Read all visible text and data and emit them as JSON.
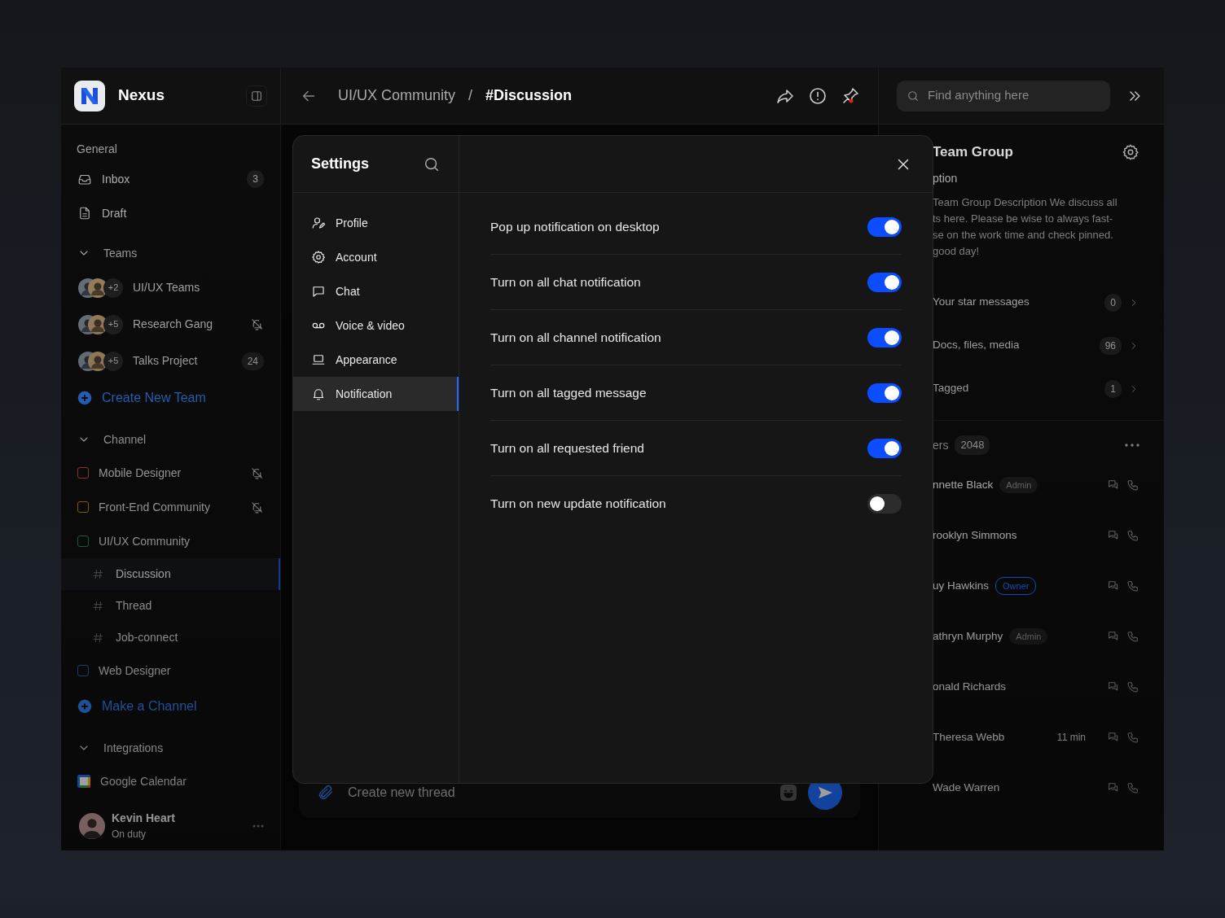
{
  "app": {
    "name": "Nexus"
  },
  "sidebar": {
    "general_label": "General",
    "general_items": [
      {
        "label": "Inbox",
        "count": "3"
      },
      {
        "label": "Draft"
      }
    ],
    "teams": {
      "label": "Teams",
      "expanded": true,
      "items": [
        {
          "name": "UI/UX Teams",
          "extra": "+2",
          "muted": false
        },
        {
          "name": "Research Gang",
          "extra": "+5",
          "muted": true
        },
        {
          "name": "Talks Project",
          "extra": "+5",
          "count": "24",
          "muted": false
        }
      ],
      "action": "Create New Team"
    },
    "channels": {
      "label": "Channel",
      "expanded": true,
      "items": [
        {
          "name": "Mobile Designer",
          "color": "#8a3434",
          "muted": true
        },
        {
          "name": "Front-End Community",
          "color": "#7a5a18",
          "muted": true
        },
        {
          "name": "UI/UX Community",
          "color": "#1a5a3a",
          "muted": false,
          "children": [
            {
              "name": "Discussion",
              "selected": true
            },
            {
              "name": "Thread",
              "selected": false
            },
            {
              "name": "Job-connect",
              "selected": false
            }
          ]
        },
        {
          "name": "Web Designer",
          "color": "#1c3f70",
          "muted": false
        }
      ],
      "action": "Make a Channel"
    },
    "integrations": {
      "label": "Integrations",
      "expanded": true,
      "items": [
        {
          "name": "Google Calendar"
        }
      ]
    },
    "user": {
      "name": "Kevin Heart",
      "status": "On duty"
    }
  },
  "header": {
    "breadcrumb": [
      "UI/UX Community",
      "#Discussion"
    ],
    "separator": "/"
  },
  "composer": {
    "placeholder": "Create new thread"
  },
  "search": {
    "placeholder": "Find anything here"
  },
  "details": {
    "title": "Team Group",
    "description_label": "ption",
    "description_lines": [
      "Team Group Description We discuss all",
      "ts here. Please be wise to always fast-",
      "se on the work time and check pinned.",
      "good day!"
    ],
    "links": [
      {
        "label": "Your star messages",
        "count": "0"
      },
      {
        "label": "Docs, files, media",
        "count": "96"
      },
      {
        "label": "Tagged",
        "count": "1"
      }
    ],
    "members_label": "ers",
    "members_count": "2048",
    "members": [
      {
        "name": "nnette Black",
        "role": "Admin",
        "role_outlined": false
      },
      {
        "name": "rooklyn Simmons"
      },
      {
        "name": "uy Hawkins",
        "role": "Owner",
        "role_outlined": true
      },
      {
        "name": "athryn Murphy",
        "role": "Admin",
        "role_outlined": false
      },
      {
        "name": "onald Richards"
      },
      {
        "name": "Theresa Webb",
        "time": "11 min"
      },
      {
        "name": "Wade Warren"
      }
    ]
  },
  "settings": {
    "title": "Settings",
    "menu": [
      {
        "label": "Profile",
        "selected": false
      },
      {
        "label": "Account",
        "selected": false
      },
      {
        "label": "Chat",
        "selected": false
      },
      {
        "label": "Voice & video",
        "selected": false
      },
      {
        "label": "Appearance",
        "selected": false
      },
      {
        "label": "Notification",
        "selected": true
      }
    ],
    "options": [
      {
        "label": "Pop up notification on desktop",
        "on": true
      },
      {
        "label": "Turn on all chat notification",
        "on": true
      },
      {
        "label": "Turn on all channel notification",
        "on": true
      },
      {
        "label": "Turn on all tagged message",
        "on": true
      },
      {
        "label": "Turn on all requested friend",
        "on": true
      },
      {
        "label": "Turn on new update notification",
        "on": false
      }
    ]
  }
}
